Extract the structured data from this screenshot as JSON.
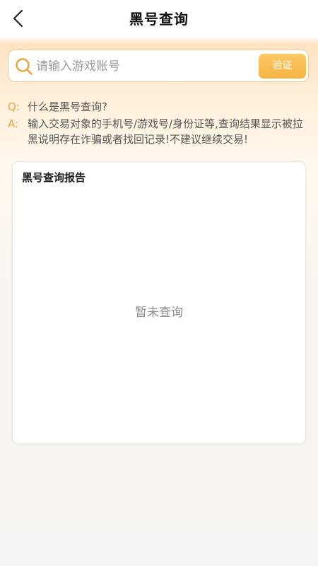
{
  "header": {
    "title": "黑号查询"
  },
  "search": {
    "placeholder": "请输入游戏账号",
    "value": "",
    "verify_label": "验证"
  },
  "faq": {
    "q_prefix": "Q:",
    "question": "什么是黑号查询?",
    "a_prefix": "A:",
    "answer": "输入交易对象的手机号/游戏号/身份证等,查询结果显示被拉黑说明存在诈骗或者找回记录!不建议继续交易!"
  },
  "report": {
    "title": "黑号查询报告",
    "empty_text": "暂未查询"
  },
  "colors": {
    "accent": "#f6b444",
    "accent_text": "#e8a443",
    "search_border": "#f0c998"
  },
  "icons": {
    "back": "chevron-left-icon",
    "search": "search-icon"
  }
}
